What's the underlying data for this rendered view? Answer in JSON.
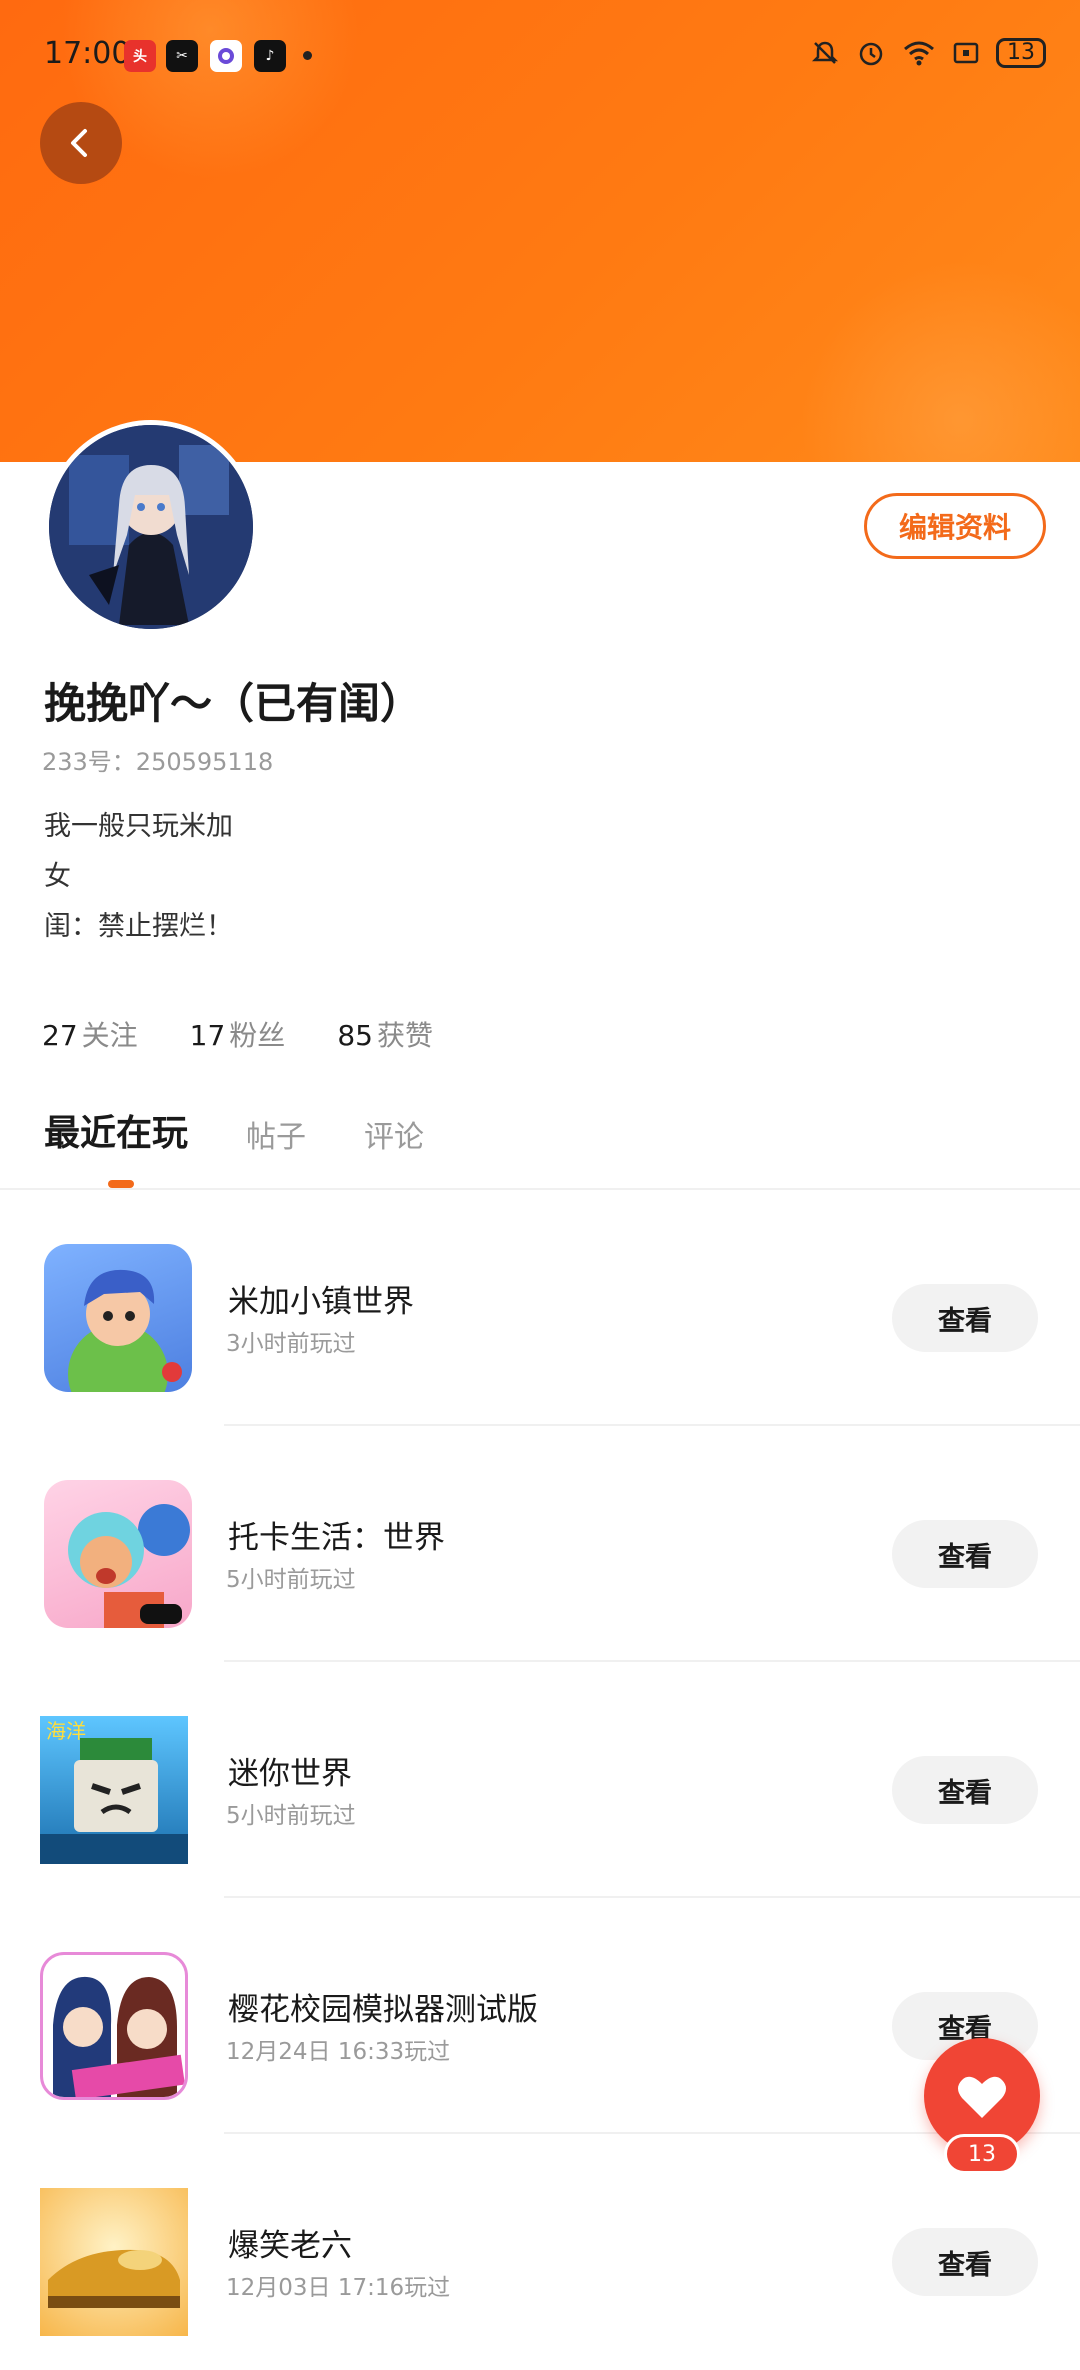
{
  "status_bar": {
    "time": "17:00",
    "apps": [
      "toutiao-icon",
      "capcut-icon",
      "browser-icon",
      "tiktok-icon"
    ],
    "battery": "13"
  },
  "profile": {
    "edit_label": "编辑资料",
    "username": "挽挽吖～（已有闺）",
    "uid": "233号：250595118",
    "bio_lines": [
      "我一般只玩米加",
      "女",
      "闺：禁止摆烂！"
    ],
    "stats": [
      {
        "count": "27",
        "label": "关注"
      },
      {
        "count": "17",
        "label": "粉丝"
      },
      {
        "count": "85",
        "label": "获赞"
      }
    ]
  },
  "tabs": [
    {
      "label": "最近在玩",
      "active": true
    },
    {
      "label": "帖子",
      "active": false
    },
    {
      "label": "评论",
      "active": false
    }
  ],
  "games": [
    {
      "name": "米加小镇世界",
      "time": "3小时前玩过",
      "button": "查看"
    },
    {
      "name": "托卡生活：世界",
      "time": "5小时前玩过",
      "button": "查看"
    },
    {
      "name": "迷你世界",
      "time": "5小时前玩过",
      "button": "查看"
    },
    {
      "name": "樱花校园模拟器测试版",
      "time": "12月24日 16:33玩过",
      "button": "查看"
    },
    {
      "name": "爆笑老六",
      "time": "12月03日 17:16玩过",
      "button": "查看"
    }
  ],
  "like": {
    "count": "13"
  },
  "colors": {
    "accent": "#f36a1a",
    "banner": "#ff7a12",
    "like": "#f04535"
  }
}
